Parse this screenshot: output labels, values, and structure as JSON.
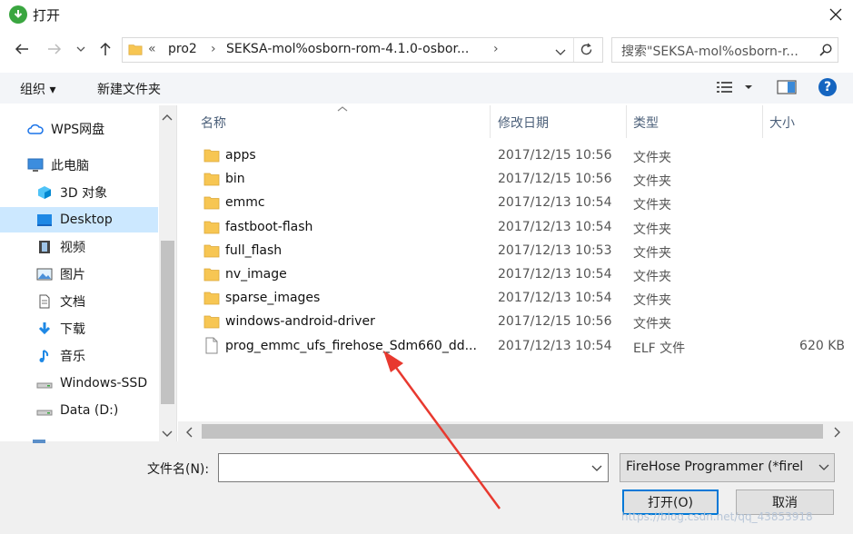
{
  "window": {
    "title": "打开"
  },
  "address": {
    "crumbs": [
      "«",
      "pro2",
      "›",
      "SEKSA-mol%osborn-rom-4.1.0-osbor...",
      "›"
    ]
  },
  "search": {
    "placeholder": "搜索\"SEKSA-mol%osborn-r..."
  },
  "toolbar": {
    "organize_label": "组织 ▾",
    "new_folder_label": "新建文件夹"
  },
  "sidebar": {
    "items": [
      {
        "label": "WPS网盘",
        "icon": "cloud-icon"
      },
      {
        "label": "此电脑",
        "icon": "computer-icon"
      },
      {
        "label": "3D 对象",
        "icon": "cube-3d-icon"
      },
      {
        "label": "Desktop",
        "icon": "desktop-icon",
        "selected": true
      },
      {
        "label": "视频",
        "icon": "video-icon"
      },
      {
        "label": "图片",
        "icon": "picture-icon"
      },
      {
        "label": "文档",
        "icon": "document-icon"
      },
      {
        "label": "下载",
        "icon": "download-icon"
      },
      {
        "label": "音乐",
        "icon": "music-icon"
      },
      {
        "label": "Windows-SSD",
        "icon": "drive-icon"
      },
      {
        "label": "Data (D:)",
        "icon": "drive-icon"
      }
    ]
  },
  "list": {
    "headers": {
      "name": "名称",
      "date": "修改日期",
      "type": "类型",
      "size": "大小"
    },
    "rows": [
      {
        "name": "apps",
        "date": "2017/12/15 10:56",
        "type": "文件夹",
        "size": "",
        "icon": "folder-icon"
      },
      {
        "name": "bin",
        "date": "2017/12/15 10:56",
        "type": "文件夹",
        "size": "",
        "icon": "folder-icon"
      },
      {
        "name": "emmc",
        "date": "2017/12/13 10:54",
        "type": "文件夹",
        "size": "",
        "icon": "folder-icon"
      },
      {
        "name": "fastboot-flash",
        "date": "2017/12/13 10:54",
        "type": "文件夹",
        "size": "",
        "icon": "folder-icon"
      },
      {
        "name": "full_flash",
        "date": "2017/12/13 10:53",
        "type": "文件夹",
        "size": "",
        "icon": "folder-icon"
      },
      {
        "name": "nv_image",
        "date": "2017/12/13 10:54",
        "type": "文件夹",
        "size": "",
        "icon": "folder-icon"
      },
      {
        "name": "sparse_images",
        "date": "2017/12/13 10:54",
        "type": "文件夹",
        "size": "",
        "icon": "folder-icon"
      },
      {
        "name": "windows-android-driver",
        "date": "2017/12/15 10:56",
        "type": "文件夹",
        "size": "",
        "icon": "folder-icon"
      },
      {
        "name": "prog_emmc_ufs_firehose_Sdm660_dd...",
        "date": "2017/12/13 10:54",
        "type": "ELF 文件",
        "size": "620 KB",
        "icon": "file-icon"
      }
    ]
  },
  "bottom": {
    "filename_label": "文件名(N):",
    "filename_value": "",
    "filter_value": "FireHose Programmer (*firel",
    "open_label": "打开(O)",
    "cancel_label": "取消",
    "watermark": "https://blog.csdn.net/qq_43853918"
  },
  "colors": {
    "accent": "#0078d7",
    "selection": "#cce8ff",
    "folder": "#f7c653",
    "annotation_arrow": "#e8392f"
  }
}
